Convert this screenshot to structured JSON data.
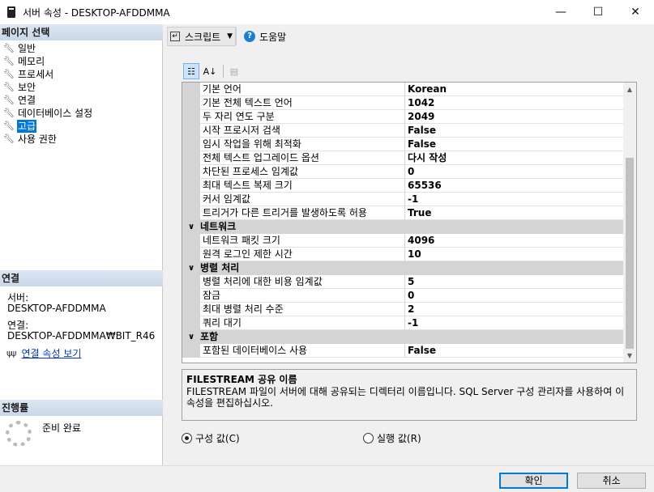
{
  "window": {
    "title": "서버 속성 - DESKTOP-AFDDMMA",
    "minimize": "—",
    "maximize": "☐",
    "close": "✕"
  },
  "left": {
    "page_select_header": "페이지 선택",
    "pages": [
      {
        "label": "일반"
      },
      {
        "label": "메모리"
      },
      {
        "label": "프로세서"
      },
      {
        "label": "보안"
      },
      {
        "label": "연결"
      },
      {
        "label": "데이터베이스 설정"
      },
      {
        "label": "고급"
      },
      {
        "label": "사용 권한"
      }
    ],
    "connection_header": "연결",
    "server_label": "서버:",
    "server_value": "DESKTOP-AFDDMMA",
    "connection_label": "연결:",
    "connection_value": "DESKTOP-AFDDMMA₩BIT_R46",
    "view_conn_props": "연결 속성 보기",
    "progress_header": "진행률",
    "progress_status": "준비 완료"
  },
  "toolbar": {
    "script_label": "스크립트",
    "help_label": "도움말"
  },
  "grid": {
    "rows": [
      {
        "name": "기본 언어",
        "value": "Korean"
      },
      {
        "name": "기본 전체 텍스트 언어",
        "value": "1042"
      },
      {
        "name": "두 자리 연도 구분",
        "value": "2049"
      },
      {
        "name": "시작 프로시저 검색",
        "value": "False"
      },
      {
        "name": "임시 작업을 위해 최적화",
        "value": "False"
      },
      {
        "name": "전체 텍스트 업그레이드 옵션",
        "value": "다시 작성"
      },
      {
        "name": "차단된 프로세스 임계값",
        "value": "0"
      },
      {
        "name": "최대 텍스트 복제 크기",
        "value": "65536"
      },
      {
        "name": "커서 임계값",
        "value": "-1"
      },
      {
        "name": "트리거가 다른 트리거를 발생하도록 허용",
        "value": "True"
      }
    ],
    "cat_network": "네트워크",
    "network_rows": [
      {
        "name": "네트워크 패킷 크기",
        "value": "4096"
      },
      {
        "name": "원격 로그인 제한 시간",
        "value": "10"
      }
    ],
    "cat_parallel": "병렬 처리",
    "parallel_rows": [
      {
        "name": "병렬 처리에 대한 비용 임계값",
        "value": "5"
      },
      {
        "name": "잠금",
        "value": "0"
      },
      {
        "name": "최대 병렬 처리 수준",
        "value": "2"
      },
      {
        "name": "쿼리 대기",
        "value": "-1"
      }
    ],
    "cat_containment": "포함",
    "containment_rows": [
      {
        "name": "포함된 데이터베이스 사용",
        "value": "False"
      }
    ]
  },
  "description": {
    "title": "FILESTREAM 공유 이름",
    "text": "FILESTREAM 파일이 서버에 대해 공유되는 디렉터리 이름입니다. SQL Server 구성 관리자를 사용하여 이 속성을 편집하십시오."
  },
  "radios": {
    "config_label": "구성 값(C)",
    "runtime_label": "실행 값(R)"
  },
  "buttons": {
    "ok": "확인",
    "cancel": "취소"
  }
}
